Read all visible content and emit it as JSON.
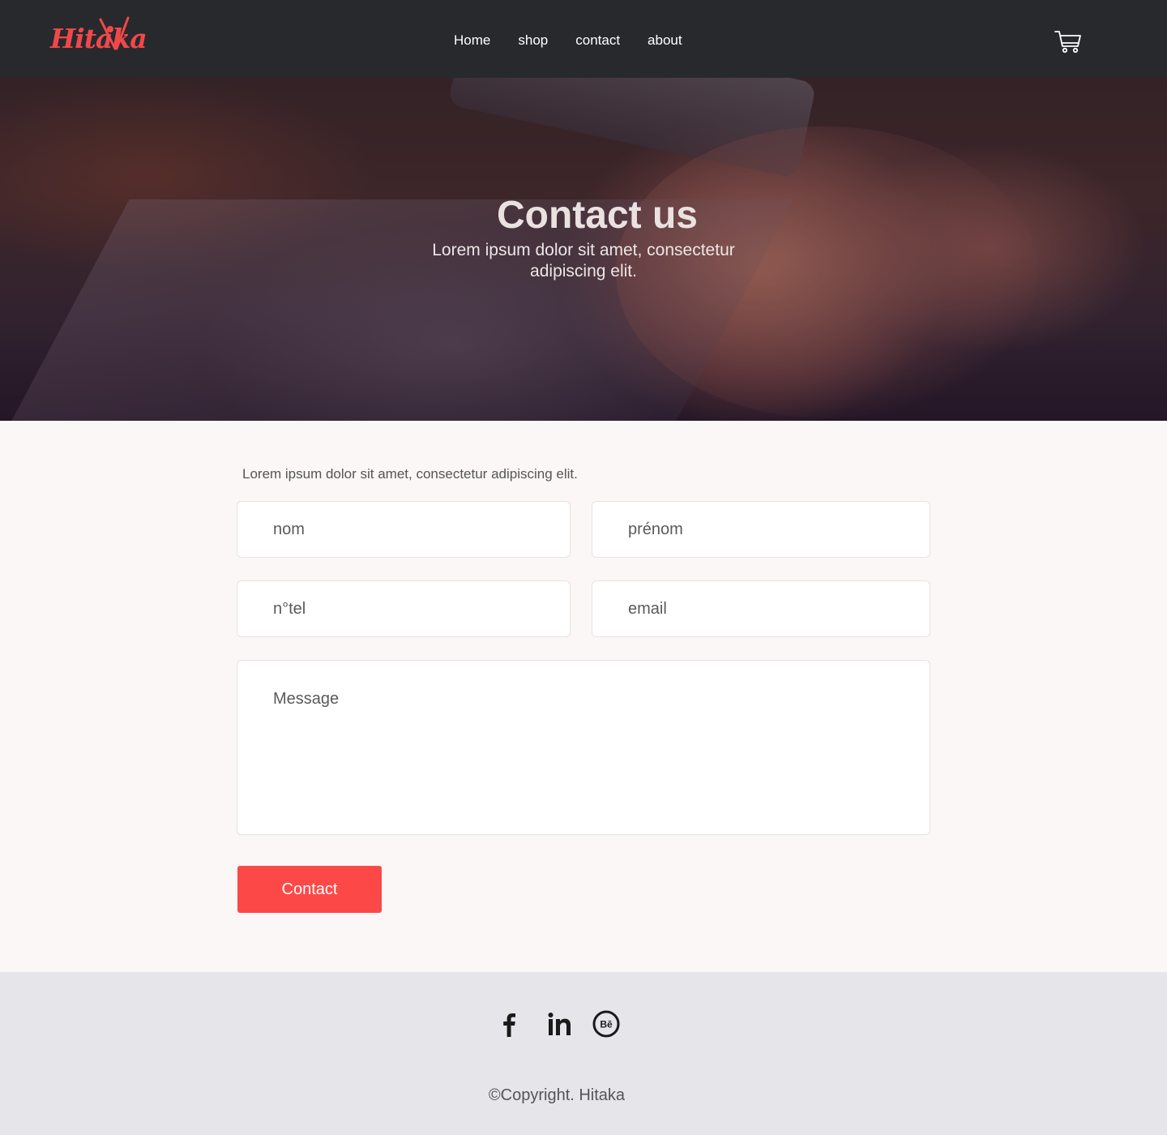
{
  "brand": {
    "logo_text": "Hitaka",
    "accent_color": "#fd4848",
    "nav_bg": "#28292d"
  },
  "nav": {
    "links": [
      "Home",
      "shop",
      "contact",
      "about"
    ],
    "cart_icon": "cart-icon"
  },
  "hero": {
    "title": "Contact us",
    "subtitle": "Lorem ipsum dolor sit amet, consectetur adipiscing elit."
  },
  "contact": {
    "intro": "Lorem ipsum dolor sit amet, consectetur adipiscing elit.",
    "fields": {
      "nom": "nom",
      "prenom": "prénom",
      "tel": "n°tel",
      "email": "email",
      "message": "Message"
    },
    "submit_label": "Contact"
  },
  "footer": {
    "social_icons": [
      "facebook-icon",
      "linkedin-icon",
      "behance-icon"
    ],
    "copyright": "©Copyright. Hitaka",
    "bg": "#e6e5ea"
  }
}
